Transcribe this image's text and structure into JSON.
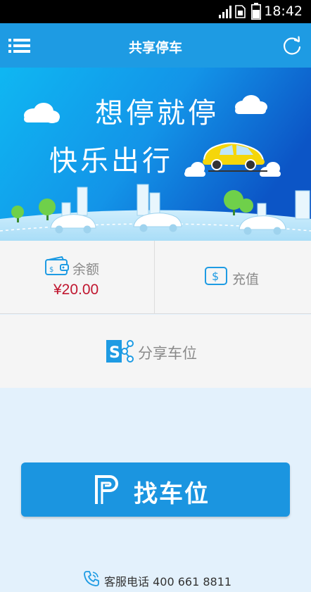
{
  "status_bar": {
    "time": "18:42"
  },
  "header": {
    "title": "共享停车"
  },
  "banner": {
    "line1": "想停就停",
    "line2": "快乐出行"
  },
  "balance": {
    "label": "余额",
    "amount": "¥20.00"
  },
  "recharge": {
    "label": "充值"
  },
  "share": {
    "label": "分享车位"
  },
  "find": {
    "label": "找车位"
  },
  "service": {
    "text": "客服电话 400 661 8811"
  },
  "colors": {
    "primary": "#1e9be3",
    "amount": "#c0162f",
    "background": "#e3f1fc"
  }
}
